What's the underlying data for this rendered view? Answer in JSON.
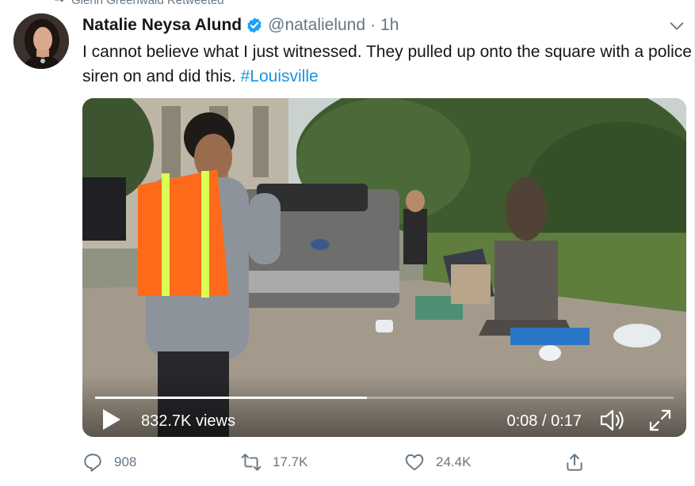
{
  "retweet_banner": {
    "text": "Glenn Greenwald Retweeted",
    "icon": "retweet-icon"
  },
  "tweet": {
    "display_name": "Natalie Neysa Alund",
    "verified": true,
    "handle": "@natalielund",
    "separator": "·",
    "time": "1h",
    "text_main": "I cannot believe what I just witnessed. They pulled up onto the square with a police siren on and did this. ",
    "hashtag": "#Louisville"
  },
  "media": {
    "views": "832.7K views",
    "current_time": "0:08",
    "time_separator": " / ",
    "duration": "0:17",
    "progress": 0.47,
    "icons": [
      "play-icon",
      "volume-icon",
      "fullscreen-icon"
    ]
  },
  "actions": {
    "replies": "908",
    "retweets": "17.7K",
    "likes": "24.4K",
    "icons": [
      "reply-icon",
      "retweet-icon",
      "like-icon",
      "share-icon"
    ]
  },
  "colors": {
    "link": "#1b95e0",
    "secondary_text": "#657786",
    "verified": "#1da1f2"
  }
}
